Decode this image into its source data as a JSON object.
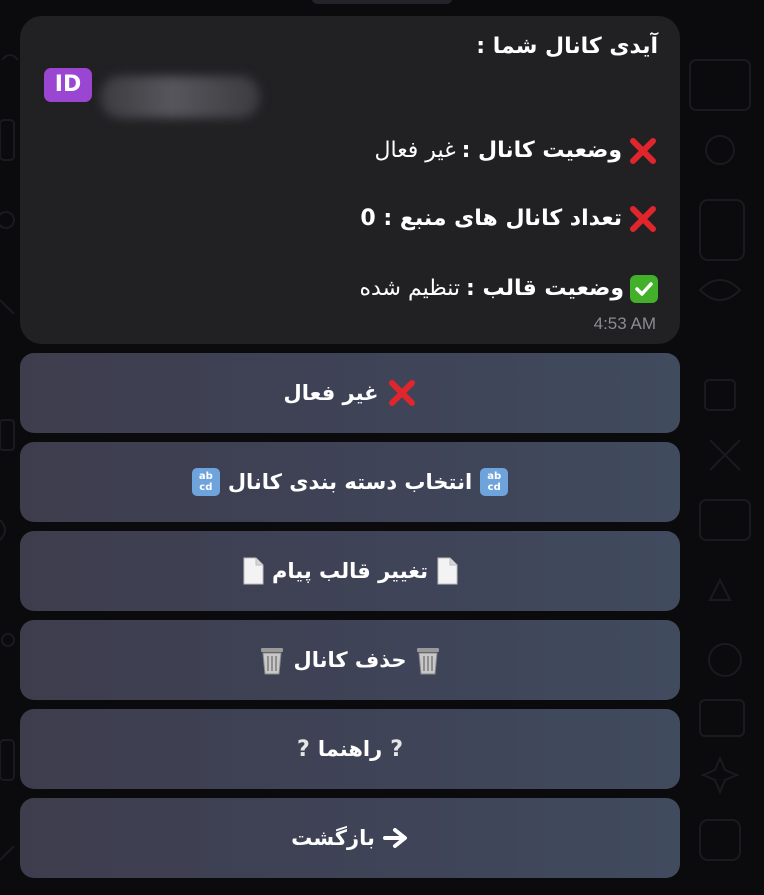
{
  "message": {
    "title": "آیدی کانال شما :",
    "id_icon": "ID",
    "lines": [
      {
        "icon": "cross-mark-icon",
        "label": "وضعیت کانال :",
        "value": "غیر فعال"
      },
      {
        "icon": "cross-mark-icon",
        "label": "تعداد کانال های منبع : 0",
        "value": ""
      },
      {
        "icon": "check-mark-icon",
        "label": "وضعیت قالب :",
        "value": "تنظیم شده"
      }
    ],
    "time": "4:53 AM"
  },
  "keyboard": {
    "buttons": [
      {
        "label": "غیر فعال",
        "icon": "cross-mark-icon"
      },
      {
        "label": "انتخاب دسته بندی کانال",
        "icon": "abcd-icon"
      },
      {
        "label": "تغییر قالب پیام",
        "icon": "page-icon"
      },
      {
        "label": "حذف کانال",
        "icon": "trash-icon"
      },
      {
        "label": "راهنما",
        "icon": "question-icon"
      },
      {
        "label": "بازگشت",
        "icon": "arrow-right-icon"
      }
    ],
    "abcd_text": "ab cd",
    "question_mark": "?"
  },
  "colors": {
    "background": "#0b0b0e",
    "bubble": "#212124",
    "button": "#3f4458",
    "cross": "#e0262c",
    "check": "#43b02a",
    "id_badge": "#9b46d3"
  }
}
